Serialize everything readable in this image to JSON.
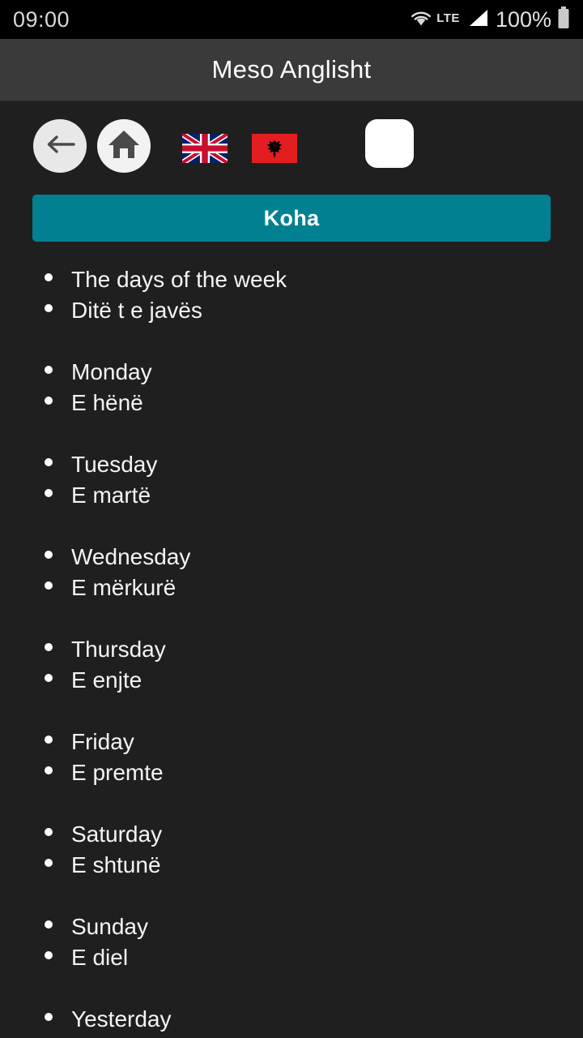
{
  "status_bar": {
    "time": "09:00",
    "network_type": "LTE",
    "battery_percent": "100%",
    "wifi_icon": "wifi-icon",
    "signal_icon": "signal-bars-icon",
    "battery_icon": "battery-full-icon"
  },
  "app_bar": {
    "title": "Meso Anglisht"
  },
  "toolbar": {
    "back_label": "back-arrow-icon",
    "home_label": "home-icon",
    "flag_en_label": "uk-flag-icon",
    "flag_sq_label": "albania-flag-icon",
    "dark_mode_label": "moon-icon"
  },
  "section": {
    "title": "Koha"
  },
  "colors": {
    "banner_teal": "#008091",
    "app_bar_gray": "#3a3a3a",
    "content_bg": "#1f1f1f",
    "status_bar_bg": "#000000",
    "text_white": "#f4f4f4",
    "flag_red": "#e41e20"
  },
  "content": {
    "groups": [
      {
        "english": "The days of the week",
        "albanian": "Ditë t e javës"
      },
      {
        "english": "Monday",
        "albanian": "E hënë"
      },
      {
        "english": "Tuesday",
        "albanian": "E martë"
      },
      {
        "english": "Wednesday",
        "albanian": "E mërkurë"
      },
      {
        "english": "Thursday",
        "albanian": "E enjte"
      },
      {
        "english": "Friday",
        "albanian": "E premte"
      },
      {
        "english": "Saturday",
        "albanian": "E shtunë"
      },
      {
        "english": "Sunday",
        "albanian": "E diel"
      },
      {
        "english": "Yesterday",
        "albanian": ""
      }
    ]
  }
}
